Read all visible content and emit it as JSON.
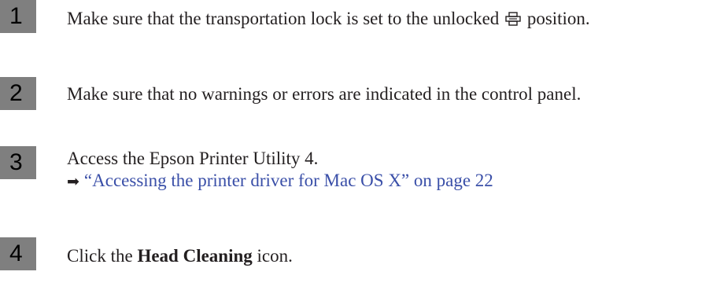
{
  "steps": [
    {
      "number": "1",
      "text_before": "Make sure that the transportation lock is set to the unlocked",
      "icon": "unlocked-transport-lock-icon",
      "text_after": "position."
    },
    {
      "number": "2",
      "text": "Make sure that no warnings or errors are indicated in the control panel."
    },
    {
      "number": "3",
      "text": "Access the Epson Printer Utility 4.",
      "link_icon": "arrow-right-icon",
      "link_text": "“Accessing the printer driver for Mac OS X” on page 22"
    },
    {
      "number": "4",
      "text_before": "Click the",
      "bold": "Head Cleaning",
      "text_after": "icon."
    }
  ],
  "colors": {
    "badge": "#7f7f7f",
    "text": "#231f20",
    "link": "#3a4fa8"
  }
}
